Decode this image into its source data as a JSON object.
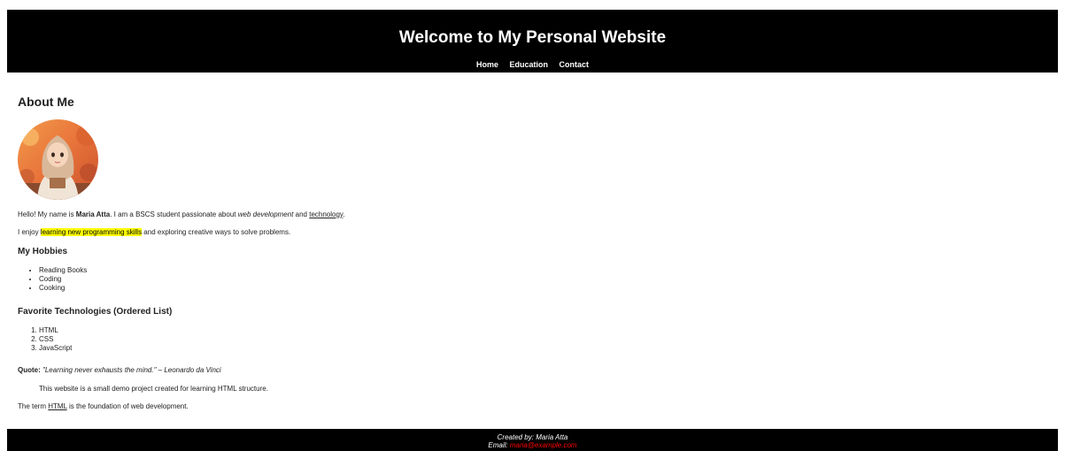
{
  "header": {
    "title": "Welcome to My Personal Website",
    "nav": [
      "Home",
      "Education",
      "Contact"
    ]
  },
  "about": {
    "heading": "About Me",
    "intro1": {
      "before_name": "Hello! My name is ",
      "name": "Maria Atta",
      "after_name": ". I am a BSCS student passionate about ",
      "em": "web development",
      "and": " and ",
      "tech": "technology",
      "end": "."
    },
    "intro2": {
      "before": "I enjoy ",
      "highlight": "learning new programming skills",
      "after": " and exploring creative ways to solve problems."
    }
  },
  "hobbies": {
    "heading": "My Hobbies",
    "items": [
      "Reading Books",
      "Coding",
      "Cooking"
    ]
  },
  "technologies": {
    "heading": "Favorite Technologies (Ordered List)",
    "items": [
      "HTML",
      "CSS",
      "JavaScript"
    ]
  },
  "quote": {
    "label": "Quote:",
    "text": "\"Learning never exhausts the mind.\" – Leonardo da Vinci"
  },
  "demo_text": "This website is a small demo project created for learning HTML structure.",
  "term": {
    "before": "The term ",
    "abbr": "HTML",
    "after": " is the foundation of web development."
  },
  "footer": {
    "created_by": "Created by: Maria Atta",
    "email_label": "Email: ",
    "email": "maria@example.com"
  },
  "colors": {
    "header_bg": "#000000",
    "highlight": "#ffff00",
    "email_link": "#ff0000"
  }
}
